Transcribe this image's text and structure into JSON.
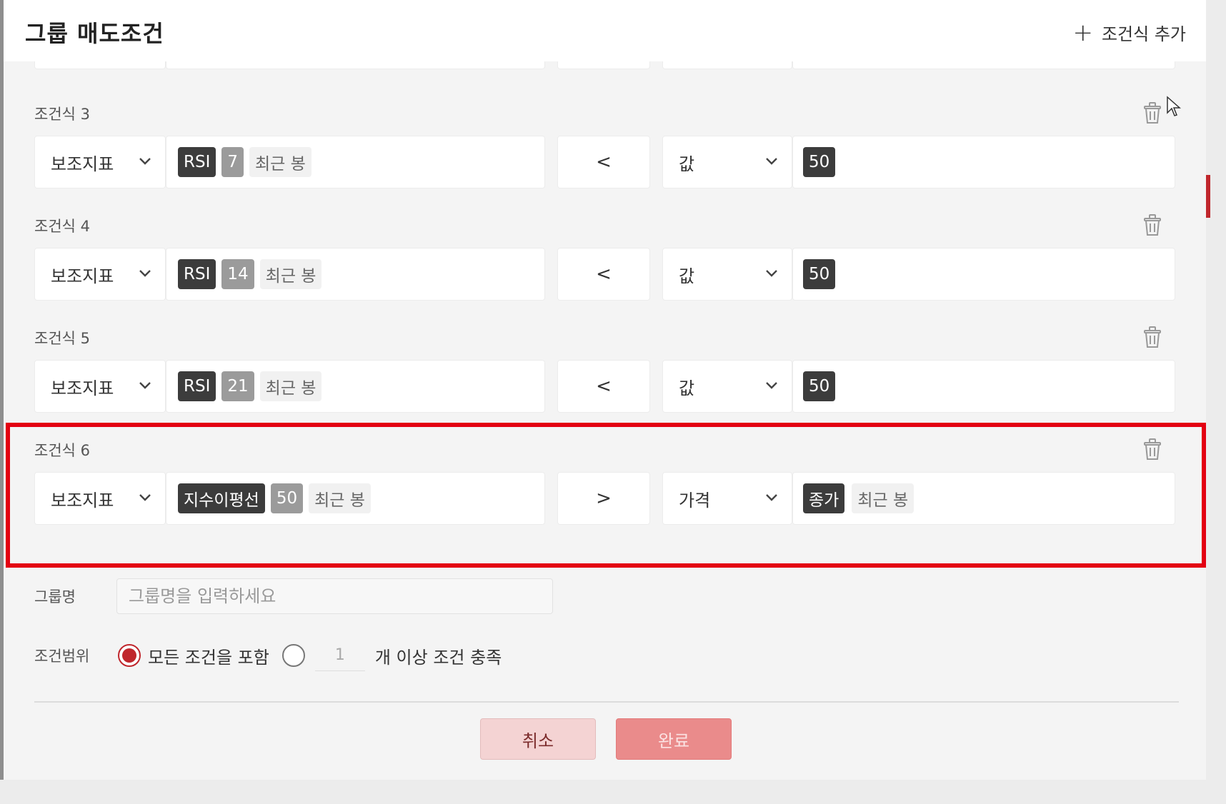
{
  "dialog": {
    "title": "그룹 매도조건",
    "add_condition_label": "조건식 추가"
  },
  "conditions": [
    {
      "label": "조건식 3",
      "left_type": "보조지표",
      "indicator": {
        "name": "RSI",
        "period": "7",
        "basis": "최근 봉"
      },
      "operator": "<",
      "right_type": "값",
      "right_value": {
        "main": "50",
        "basis": ""
      }
    },
    {
      "label": "조건식 4",
      "left_type": "보조지표",
      "indicator": {
        "name": "RSI",
        "period": "14",
        "basis": "최근 봉"
      },
      "operator": "<",
      "right_type": "값",
      "right_value": {
        "main": "50",
        "basis": ""
      }
    },
    {
      "label": "조건식 5",
      "left_type": "보조지표",
      "indicator": {
        "name": "RSI",
        "period": "21",
        "basis": "최근 봉"
      },
      "operator": "<",
      "right_type": "값",
      "right_value": {
        "main": "50",
        "basis": ""
      }
    },
    {
      "label": "조건식 6",
      "left_type": "보조지표",
      "indicator": {
        "name": "지수이평선",
        "period": "50",
        "basis": "최근 봉"
      },
      "operator": ">",
      "right_type": "가격",
      "right_value": {
        "main": "종가",
        "basis": "최근 봉"
      }
    }
  ],
  "group_name": {
    "label": "그룹명",
    "placeholder": "그룹명을 입력하세요"
  },
  "condition_range": {
    "label": "조건범위",
    "option_all": "모든 조건을 포함",
    "count_value": "1",
    "option_count_suffix": "개 이상 조건 충족"
  },
  "buttons": {
    "cancel": "취소",
    "done": "완료"
  },
  "colors": {
    "accent": "#c0262c",
    "highlight_border": "#e30012",
    "tag_dark": "#3c3c3c",
    "tag_gray": "#9b9b9b"
  }
}
